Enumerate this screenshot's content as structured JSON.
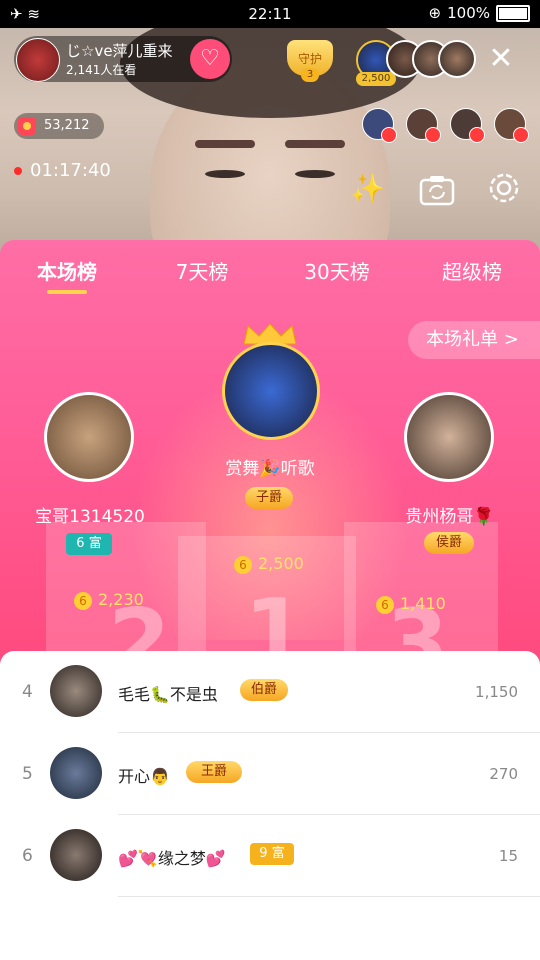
{
  "status_bar": {
    "time": "22:11",
    "battery": "100%"
  },
  "host": {
    "name": "じ☆ve萍儿重来",
    "viewers": "2,141人在看"
  },
  "guard": {
    "label": "守护",
    "count": "3"
  },
  "top_viewer_score": "2,500",
  "coins": "53,212",
  "timer": "01:17:40",
  "tabs": [
    "本场榜",
    "7天榜",
    "30天榜",
    "超级榜"
  ],
  "gift_list_label": "本场礼单 >",
  "podium": {
    "first": {
      "name": "赏舞🎉听歌",
      "badge": "子爵",
      "score": "2,500"
    },
    "second": {
      "name": "宝哥1314520",
      "badge": "6 富",
      "score": "2,230"
    },
    "third": {
      "name": "贵州杨哥🌹",
      "badge": "侯爵",
      "score": "1,410"
    }
  },
  "ranking": [
    {
      "rank": "4",
      "name": "毛毛🐛不是虫",
      "badge": "伯爵",
      "value": "1,150"
    },
    {
      "rank": "5",
      "name": "开心👨",
      "badge": "王爵",
      "value": "270"
    },
    {
      "rank": "6",
      "name": "💕💘缘之梦💕",
      "badge": "9 富",
      "value": "15"
    }
  ],
  "icons": [
    "airplane-icon",
    "wifi-icon",
    "heart-plus-icon",
    "close-icon",
    "magic-wand-icon",
    "camera-flip-icon",
    "gear-icon",
    "crown-icon",
    "coin-icon"
  ]
}
